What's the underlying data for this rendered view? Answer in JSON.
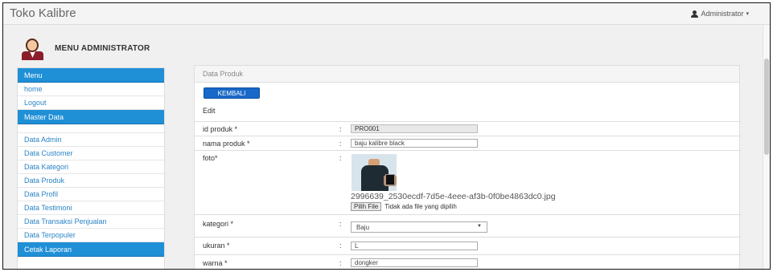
{
  "app": {
    "title": "Toko Kalibre"
  },
  "user_menu": {
    "label": "Administrator",
    "icon": "user-icon",
    "caret": "▾"
  },
  "header": {
    "title": "MENU ADMINISTRATOR",
    "avatar_icon": "admin-avatar"
  },
  "sidebar": {
    "menu_heading": "Menu",
    "menu_items": [
      "home",
      "Logout"
    ],
    "master_heading": "Master Data",
    "master_items": [
      "Data Admin",
      "Data Customer",
      "Data Kategori",
      "Data Produk",
      "Data Profil",
      "Data Testimoni",
      "Data Transaksi Penjualan",
      "Data Terpopuler"
    ],
    "report_heading": "Cetak Laporan"
  },
  "panel": {
    "title": "Data Produk",
    "back_button": "KEMBALI",
    "mode": "Edit",
    "separator": ":",
    "fields": {
      "id": {
        "label": "id produk *",
        "value": "PRO001"
      },
      "name": {
        "label": "nama produk *",
        "value": "baju kalibre black"
      },
      "photo": {
        "label": "foto*",
        "filename": "2996639_2530ecdf-7d5e-4eee-af3b-0f0be4863dc0.jpg",
        "choose_button": "Pilih File",
        "status": "Tidak ada file yang dipilih"
      },
      "category": {
        "label": "kategori *",
        "value": "Baju"
      },
      "size": {
        "label": "ukuran *",
        "value": "L"
      },
      "color": {
        "label": "warna *",
        "value": "dongker"
      }
    }
  },
  "colors": {
    "accent": "#1f8fd6",
    "button": "#1768c8",
    "link": "#2a84c6"
  }
}
